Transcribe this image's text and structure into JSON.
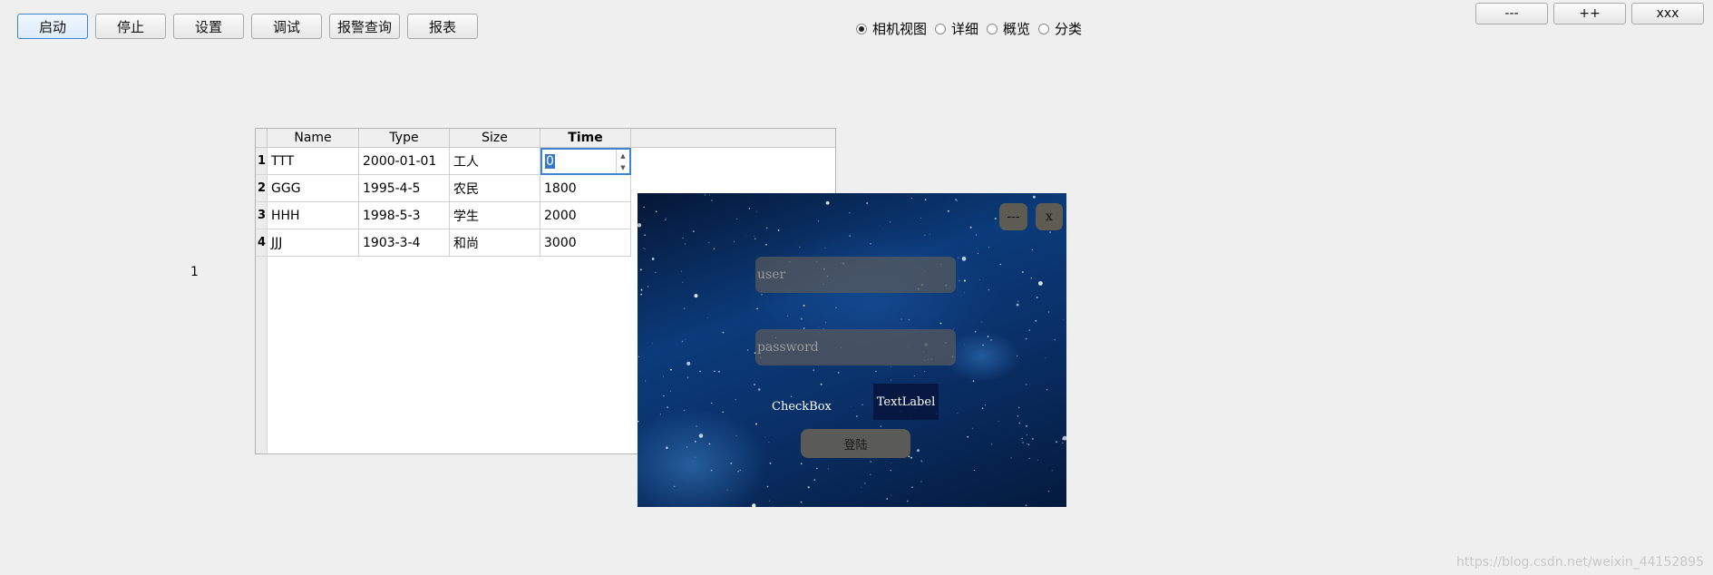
{
  "toolbar": {
    "buttons": [
      "启动",
      "停止",
      "设置",
      "调试",
      "报警查询",
      "报表"
    ]
  },
  "view_options": {
    "options": [
      "相机视图",
      "详细",
      "概览",
      "分类"
    ],
    "selected": "相机视图"
  },
  "top_right_buttons": [
    "---",
    "++",
    "xxx"
  ],
  "side_number": "1",
  "table": {
    "columns": [
      "Name",
      "Type",
      "Size",
      "Time"
    ],
    "rows": [
      {
        "index": "1",
        "name": "TTT",
        "type": "2000-01-01",
        "size": "工人",
        "time": "0"
      },
      {
        "index": "2",
        "name": "GGG",
        "type": "1995-4-5",
        "size": "农民",
        "time": "1800"
      },
      {
        "index": "3",
        "name": "HHH",
        "type": "1998-5-3",
        "size": "学生",
        "time": "2000"
      },
      {
        "index": "4",
        "name": "JJJ",
        "type": "1903-3-4",
        "size": "和尚",
        "time": "3000"
      }
    ]
  },
  "login": {
    "minimize_label": "---",
    "close_label": "x",
    "user_placeholder": "user",
    "password_placeholder": "password",
    "checkbox_label": "CheckBox",
    "text_label": "TextLabel",
    "login_button": "登陆"
  },
  "watermark": "https://blog.csdn.net/weixin_44152895",
  "colors": {
    "window_bg": "#efefef",
    "selection": "#3577c2",
    "login_field_bg": "#5a5a5a"
  }
}
